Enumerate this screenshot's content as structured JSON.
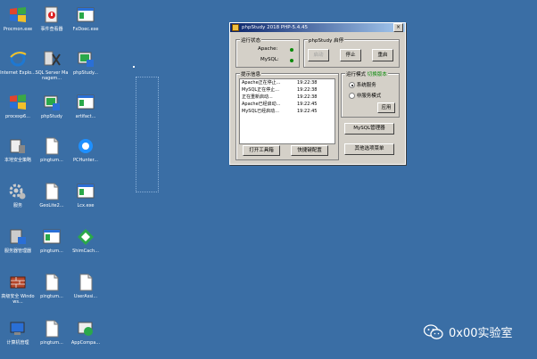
{
  "desktop": {
    "icons": [
      {
        "label": "Procmon.exe",
        "icon": "windows-flag-icon",
        "col": 0,
        "row": 0
      },
      {
        "label": "事件查看器",
        "icon": "event-viewer-icon",
        "col": 1,
        "row": 0
      },
      {
        "label": "FxDoec.exe",
        "icon": "app-window-icon",
        "col": 2,
        "row": 0
      },
      {
        "label": "Internet Explo...",
        "icon": "internet-explorer-icon",
        "col": 0,
        "row": 1
      },
      {
        "label": "SQL Server Managem...",
        "icon": "sql-server-icon",
        "col": 1,
        "row": 1
      },
      {
        "label": "phpStudy...",
        "icon": "phpstudy-icon",
        "col": 2,
        "row": 1
      },
      {
        "label": "procexp6...",
        "icon": "windows-flag-icon",
        "col": 0,
        "row": 2
      },
      {
        "label": "phpStudy",
        "icon": "phpstudy-icon",
        "col": 1,
        "row": 2
      },
      {
        "label": "artifact...",
        "icon": "app-window-icon",
        "col": 2,
        "row": 2
      },
      {
        "label": "本地安全策略",
        "icon": "security-policy-icon",
        "col": 0,
        "row": 3
      },
      {
        "label": "pingtum...",
        "icon": "document-icon",
        "col": 1,
        "row": 3
      },
      {
        "label": "PCHunter...",
        "icon": "pchunter-icon",
        "col": 2,
        "row": 3
      },
      {
        "label": "服务",
        "icon": "services-gear-icon",
        "col": 0,
        "row": 4
      },
      {
        "label": "GeoLite2...",
        "icon": "document-icon",
        "col": 1,
        "row": 4
      },
      {
        "label": "Lcx.exe",
        "icon": "app-window-icon",
        "col": 2,
        "row": 4
      },
      {
        "label": "服务器管理器",
        "icon": "server-manager-icon",
        "col": 0,
        "row": 5
      },
      {
        "label": "pingtum...",
        "icon": "app-window-icon",
        "col": 1,
        "row": 5
      },
      {
        "label": "ShimCach...",
        "icon": "shimcache-icon",
        "col": 2,
        "row": 5
      },
      {
        "label": "高级安全 Windows...",
        "icon": "firewall-icon",
        "col": 0,
        "row": 6
      },
      {
        "label": "pingtum...",
        "icon": "document-icon",
        "col": 1,
        "row": 6
      },
      {
        "label": "UserAssi...",
        "icon": "document-icon",
        "col": 2,
        "row": 6
      },
      {
        "label": "计算机管理",
        "icon": "computer-management-icon",
        "col": 0,
        "row": 7
      },
      {
        "label": "pingtum...",
        "icon": "document-icon",
        "col": 1,
        "row": 7
      },
      {
        "label": "AppCompa...",
        "icon": "appcompat-icon",
        "col": 2,
        "row": 7
      }
    ]
  },
  "window": {
    "title": "phpStudy 2018  PHP-5.4.45",
    "close_label": "×",
    "status_group": {
      "legend": "运行状态",
      "apache_label": "Apache:",
      "mysql_label": "MySQL:",
      "status_color": "#0a8a0a"
    },
    "phpstudy_group": {
      "legend": "phpStudy  启停",
      "start": "启动",
      "stop": "停止",
      "restart": "重启"
    },
    "log_group": {
      "legend": "提示信息",
      "rows": [
        {
          "msg": "Apache正在停止...",
          "time": "19:22:38"
        },
        {
          "msg": "MySQL正在停止...",
          "time": "19:22:38"
        },
        {
          "msg": "正在重新启动...",
          "time": "19:22:38"
        },
        {
          "msg": "Apache已经启动...",
          "time": "19:22:45"
        },
        {
          "msg": "MySQL已经启动...",
          "time": "19:22:45"
        }
      ]
    },
    "mode_group": {
      "legend": "运行模式",
      "switch_label": "切换版本",
      "system_service": "系统服务",
      "non_service": "非服务模式",
      "apply": "应用"
    },
    "buttons": {
      "mysql_manager": "MySQL管理器",
      "open_tools": "打开工具箱",
      "shortcut_config": "快捷键配置",
      "other_menu": "其他选项菜单"
    }
  },
  "watermark": {
    "text": "0x00实验室",
    "icon": "wechat-icon"
  }
}
